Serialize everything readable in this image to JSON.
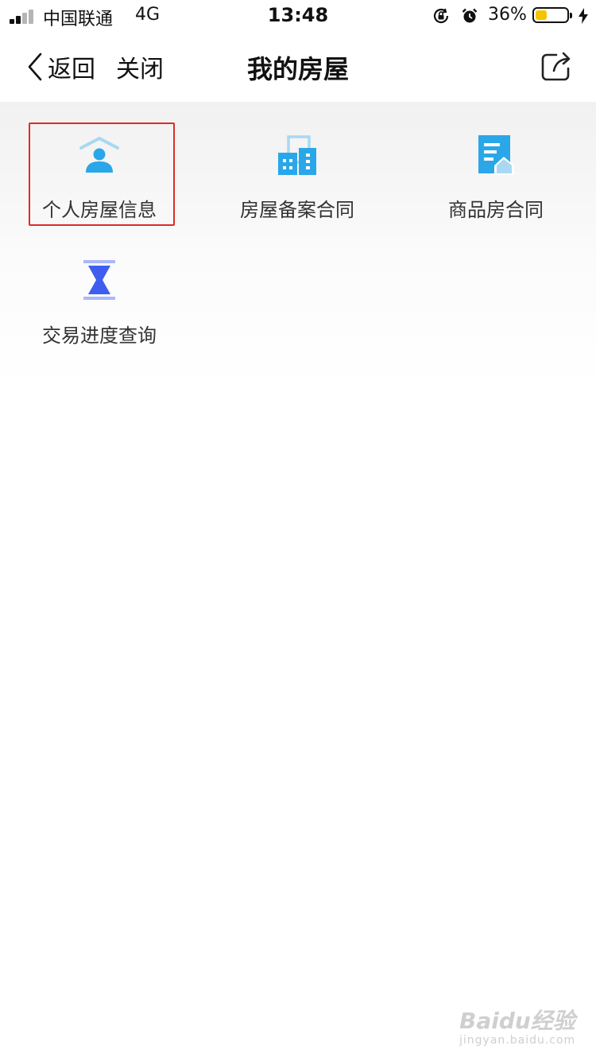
{
  "status_bar": {
    "carrier": "中国联通",
    "network": "4G",
    "time": "13:48",
    "battery_percent": "36%",
    "battery_level": 0.36,
    "signal_bars_filled": 2,
    "signal_bars_total": 4
  },
  "nav": {
    "back_label": "返回",
    "close_label": "关闭",
    "title": "我的房屋"
  },
  "grid": {
    "items": [
      {
        "label": "个人房屋信息",
        "icon": "person-house-icon",
        "highlighted": true
      },
      {
        "label": "房屋备案合同",
        "icon": "buildings-icon",
        "highlighted": false
      },
      {
        "label": "商品房合同",
        "icon": "document-house-icon",
        "highlighted": false
      },
      {
        "label": "交易进度查询",
        "icon": "hourglass-icon",
        "highlighted": false
      }
    ]
  },
  "colors": {
    "accent_blue": "#2aa7e8",
    "light_blue": "#a9d8f2",
    "hourglass_blue": "#3f5ef0",
    "highlight_red": "#e02b25"
  },
  "watermark": {
    "brand": "Baidu经验",
    "url": "jingyan.baidu.com"
  }
}
